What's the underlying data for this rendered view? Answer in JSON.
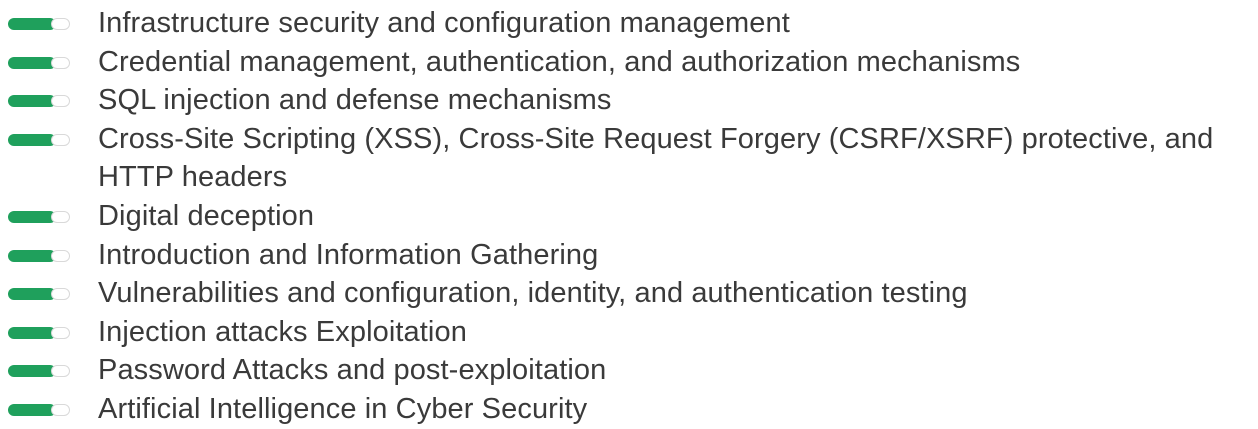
{
  "accent_color": "#1fa05c",
  "bullet_icon": "toggle-bullet-icon",
  "topics": [
    {
      "label": "Infrastructure security and configuration management"
    },
    {
      "label": "Credential management, authentication, and authorization mechanisms"
    },
    {
      "label": "SQL injection and defense mechanisms"
    },
    {
      "label": "Cross-Site Scripting (XSS), Cross-Site Request Forgery (CSRF/XSRF) protective, and HTTP headers"
    },
    {
      "label": "Digital deception"
    },
    {
      "label": "Introduction and Information Gathering"
    },
    {
      "label": "Vulnerabilities and configuration, identity, and authentication testing"
    },
    {
      "label": "Injection attacks Exploitation"
    },
    {
      "label": "Password Attacks and post-exploitation"
    },
    {
      "label": "Artificial Intelligence in Cyber Security"
    }
  ]
}
